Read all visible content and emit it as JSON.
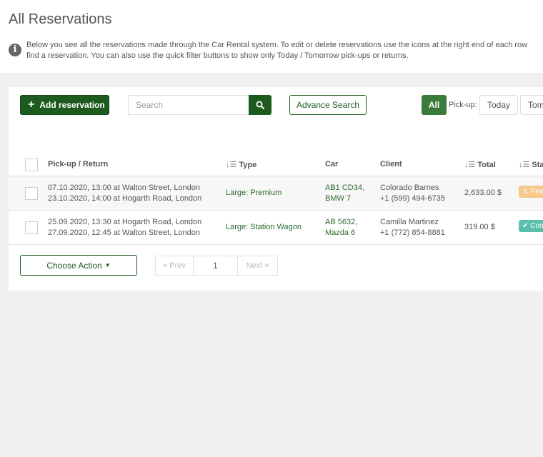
{
  "page": {
    "title": "All Reservations",
    "intro_line1": "Below you see all the reservations made through the Car Rental system. To edit or delete reservations use the icons at the right end of each row",
    "intro_line2": "find a reservation. You can also use the quick filter buttons to show only Today / Tomorrow pick-ups or returns."
  },
  "toolbar": {
    "add_label": "Add reservation",
    "search_placeholder": "Search",
    "advance_search_label": "Advance Search",
    "all_label": "All",
    "pickup_label": "Pick-up:",
    "today_label": "Today",
    "tomorrow_label": "Tomorrow"
  },
  "table": {
    "headers": {
      "pickup_return": "Pick-up / Return",
      "type": "Type",
      "car": "Car",
      "client": "Client",
      "total": "Total",
      "status": "Status"
    },
    "rows": [
      {
        "pickup": "07.10.2020, 13:00 at Walton Street, London",
        "return": "23.10.2020, 14:00 at Hogarth Road, London",
        "type": "Large: Premium",
        "car_plate": "AB1 CD34,",
        "car_model": "BMW 7",
        "client_name": "Colorado Barnes",
        "client_phone": "+1 (599) 494-6735",
        "total": "2,633.00 $",
        "status": "Pending",
        "status_color": "#f6c98b"
      },
      {
        "pickup": "25.09.2020, 13:30 at Hogarth Road, London",
        "return": "27.09.2020, 12:45 at Walton Street, London",
        "type": "Large: Station Wagon",
        "car_plate": "AB 5632,",
        "car_model": "Mazda 6",
        "client_name": "Camilla Martinez",
        "client_phone": "+1 (772) 854-8881",
        "total": "319.00 $",
        "status": "Confirmed",
        "status_color": "#5bbfae"
      }
    ]
  },
  "footer": {
    "choose_action_label": "Choose Action",
    "prev_label": "« Prev",
    "current_page": "1",
    "next_label": "Next »"
  },
  "colors": {
    "brand_green": "#1d5a1d",
    "filter_active": "#3a7a3a"
  }
}
